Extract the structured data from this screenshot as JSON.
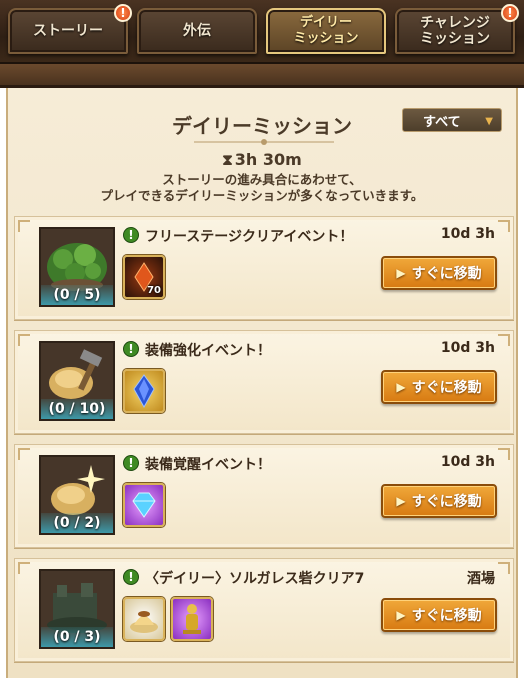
{
  "tabs": [
    {
      "label": "ストーリー",
      "badge": "!",
      "active": false
    },
    {
      "label": "外伝",
      "active": false
    },
    {
      "label_line1": "デイリー",
      "label_line2": "ミッション",
      "active": true
    },
    {
      "label_line1": "チャレンジ",
      "label_line2": "ミッション",
      "badge": "!",
      "active": false
    }
  ],
  "header": {
    "title": "デイリーミッション",
    "filter": "すべて",
    "timer": "3h 30m",
    "desc_line1": "ストーリーの進み具合にあわせて、",
    "desc_line2": "プレイできるデイリーミッションが多くなっていきます。"
  },
  "missions": [
    {
      "title": "フリーステージクリアイベント！",
      "time": "10d 3h",
      "progress": "(0 / 5)",
      "thumb_icon": "forest-icon",
      "rewards": [
        {
          "icon": "fire-crystal-icon",
          "count": "70"
        }
      ],
      "button": "すぐに移動"
    },
    {
      "title": "装備強化イベント！",
      "time": "10d 3h",
      "progress": "(0 / 10)",
      "thumb_icon": "gold-hammer-icon",
      "rewards": [
        {
          "icon": "blue-gem-icon",
          "count": ""
        }
      ],
      "button": "すぐに移動"
    },
    {
      "title": "装備覚醒イベント！",
      "time": "10d 3h",
      "progress": "(0 / 2)",
      "thumb_icon": "gold-sparkle-icon",
      "rewards": [
        {
          "icon": "diamond-icon",
          "count": ""
        }
      ],
      "button": "すぐに移動"
    },
    {
      "title": "〈デイリー〉ソルガレス砦クリア7",
      "time": "酒場",
      "progress": "(0 / 3)",
      "thumb_icon": "fortress-icon",
      "rewards": [
        {
          "icon": "pudding-icon",
          "count": ""
        },
        {
          "icon": "gold-statue-icon",
          "count": ""
        }
      ],
      "button": "すぐに移動"
    }
  ],
  "colors": {
    "accent": "#d77a12",
    "progress": "#3cabbd",
    "parchment": "#f4e8cf"
  }
}
